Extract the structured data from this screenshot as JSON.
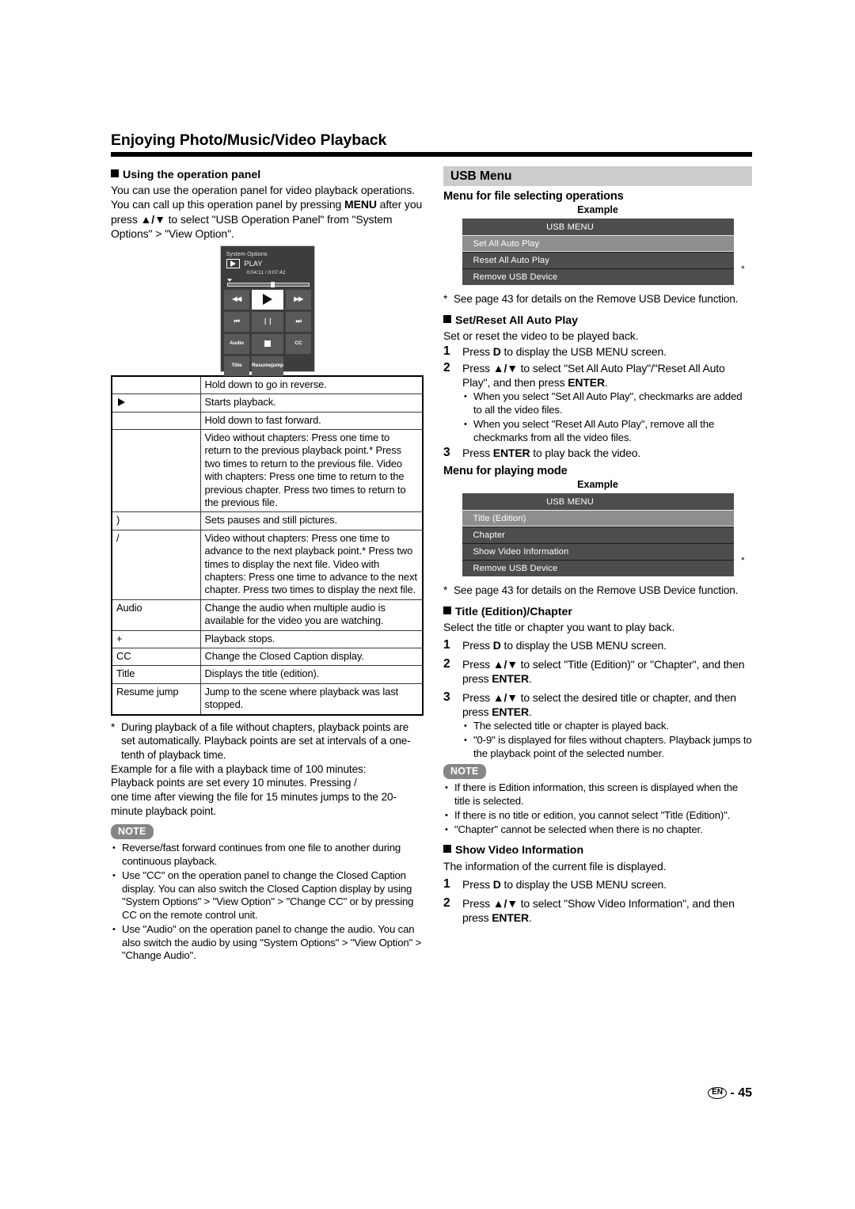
{
  "header": {
    "title": "Enjoying Photo/Music/Video Playback"
  },
  "footer": {
    "lang_badge": "EN",
    "separator": "-",
    "page_number": "45"
  },
  "left_column": {
    "section_title": "Using the operation panel",
    "intro_p1": "You can use the operation panel for video playback operations.",
    "intro_p2_a": "You can call up this operation panel by pressing ",
    "intro_p2_menu": "MENU",
    "intro_p2_b": " after you press ",
    "intro_p2_arrows": "▲/▼",
    "intro_p2_c": " to select \"USB Operation Panel\" from \"System Options\" > \"View Option\".",
    "operation_panel": {
      "system_options_label": "System Options",
      "play_label": "PLAY",
      "time": "0:04:11 / 0:07:42",
      "buttons": {
        "rewind": "◀◀",
        "play": "play-triangle",
        "fast_forward": "▶▶",
        "previous": "⏮",
        "pause": "❘❘",
        "next": "⏭",
        "audio": "Audio",
        "stop": "stop-square",
        "cc": "CC",
        "title": "Title",
        "resume_jump_line1": "Resume",
        "resume_jump_line2": "jump"
      }
    },
    "key_table": [
      {
        "key": "",
        "icon": "none",
        "desc": "Hold down to go in reverse."
      },
      {
        "key": "",
        "icon": "triangle-right",
        "desc": "Starts playback."
      },
      {
        "key": "",
        "icon": "none",
        "desc": "Hold down to fast forward."
      },
      {
        "key": "",
        "icon": "none",
        "desc": "Video without chapters: Press one time to return to the previous playback point.* Press two times to return to the previous file. Video with chapters: Press one time to return to the previous chapter. Press two times to return to the previous file."
      },
      {
        "key": ")",
        "icon": "none",
        "desc": "Sets pauses and still pictures."
      },
      {
        "key": "/",
        "icon": "none",
        "desc": "Video without chapters: Press one time to advance to the next playback point.* Press two times to display the next file. Video with chapters: Press one time to advance to the next chapter. Press two times to display the next file."
      },
      {
        "key": "Audio",
        "icon": "none",
        "desc": "Change the audio when multiple audio is available for the video you are watching."
      },
      {
        "key": "+",
        "icon": "none",
        "desc": "Playback stops."
      },
      {
        "key": "CC",
        "icon": "none",
        "desc": "Change the Closed Caption display."
      },
      {
        "key": "Title",
        "icon": "none",
        "desc": "Displays the title (edition)."
      },
      {
        "key": "Resume jump",
        "icon": "none",
        "desc": "Jump to the scene where playback was last stopped."
      }
    ],
    "footnote_star": "*",
    "footnote_text": "During playback of a file without chapters, playback points are set automatically. Playback points are set at intervals of a one-tenth of playback time.",
    "example_line1": "Example for a file with a playback time of 100 minutes:",
    "example_line2_a": "Playback points are set every 10 minutes. Pressing ",
    "example_line2_key": "/",
    "example_line3": "one time after viewing the file for 15 minutes jumps to the 20-minute playback point.",
    "note_badge": "NOTE",
    "notes": [
      "Reverse/fast forward continues from one file to another during continuous playback.",
      "Use \"CC\" on the operation panel to change the Closed Caption display. You can also switch the Closed Caption display by using \"System Options\" > \"View Option\" > \"Change CC\" or by pressing CC on the remote control unit.",
      "Use \"Audio\" on the operation panel to change the audio. You can also switch the audio by using \"System Options\" > \"View Option\" > \"Change Audio\"."
    ],
    "note2_bold_token": "CC"
  },
  "right_column": {
    "banner_title": "USB Menu",
    "sub_head_1": "Menu for file selecting operations",
    "example_label_1": "Example",
    "usb_menu_1": {
      "title": "USB MENU",
      "items": [
        {
          "label": "Set All Auto Play",
          "selected": true,
          "star": false
        },
        {
          "label": "Reset All Auto Play",
          "selected": false,
          "star": false
        },
        {
          "label": "Remove USB Device",
          "selected": false,
          "star": true
        }
      ]
    },
    "footnote_1_star": "*",
    "footnote_1_text": "See page 43 for details on the Remove USB Device function.",
    "section_2_title": "Set/Reset All Auto Play",
    "section_2_intro": "Set or reset the video to be played back.",
    "section_2_steps": [
      {
        "num": "1",
        "text_a": "Press ",
        "bold_1": "D",
        "text_b": " to display the USB MENU screen.",
        "bold_2": "",
        "text_c": ""
      },
      {
        "num": "2",
        "text_a": "Press ",
        "bold_1": "▲/▼",
        "text_b": " to select \"Set All Auto Play\"/\"Reset All Auto Play\", and then press ",
        "bold_2": "ENTER",
        "text_c": "."
      },
      {
        "num": "3",
        "text_a": "Press ",
        "bold_1": "ENTER",
        "text_b": " to play back the video.",
        "bold_2": "",
        "text_c": ""
      }
    ],
    "section_2_bullets": [
      "When you select \"Set All Auto Play\", checkmarks are added to all the video files.",
      "When you select \"Reset All Auto Play\", remove all the checkmarks from all the video files."
    ],
    "sub_head_2": "Menu for playing mode",
    "example_label_2": "Example",
    "usb_menu_2": {
      "title": "USB MENU",
      "items": [
        {
          "label": "Title (Edition)",
          "selected": true,
          "star": false
        },
        {
          "label": "Chapter",
          "selected": false,
          "star": false
        },
        {
          "label": "Show Video Information",
          "selected": false,
          "star": false
        },
        {
          "label": "Remove USB Device",
          "selected": false,
          "star": true
        }
      ]
    },
    "footnote_2_star": "*",
    "footnote_2_text": "See page 43 for details on the Remove USB Device function.",
    "section_3_title": "Title (Edition)/Chapter",
    "section_3_intro": "Select the title or chapter you want to play back.",
    "section_3_steps": [
      {
        "num": "1",
        "text_a": "Press ",
        "bold_1": "D",
        "text_b": " to display the USB MENU screen.",
        "bold_2": "",
        "text_c": ""
      },
      {
        "num": "2",
        "text_a": "Press ",
        "bold_1": "▲/▼",
        "text_b": " to select \"Title (Edition)\" or \"Chapter\", and then press ",
        "bold_2": "ENTER",
        "text_c": "."
      },
      {
        "num": "3",
        "text_a": "Press ",
        "bold_1": "▲/▼",
        "text_b": " to select the desired title or chapter, and then press ",
        "bold_2": "ENTER",
        "text_c": "."
      }
    ],
    "section_3_bullets": [
      "The selected title or chapter is played back.",
      "\"0-9\" is displayed for files without chapters. Playback jumps to the playback point of the selected number."
    ],
    "note_badge": "NOTE",
    "notes": [
      "If there is Edition information, this screen is displayed when the title is selected.",
      "If there is no title or edition, you cannot select \"Title (Edition)\".",
      "\"Chapter\" cannot be selected when there is no chapter."
    ],
    "section_4_title": "Show Video Information",
    "section_4_intro": "The information of the current file is displayed.",
    "section_4_steps": [
      {
        "num": "1",
        "text_a": "Press ",
        "bold_1": "D",
        "text_b": " to display the USB MENU screen.",
        "bold_2": "",
        "text_c": ""
      },
      {
        "num": "2",
        "text_a": "Press ",
        "bold_1": "▲/▼",
        "text_b": " to select \"Show Video Information\", and then press ",
        "bold_2": "ENTER",
        "text_c": "."
      }
    ]
  }
}
